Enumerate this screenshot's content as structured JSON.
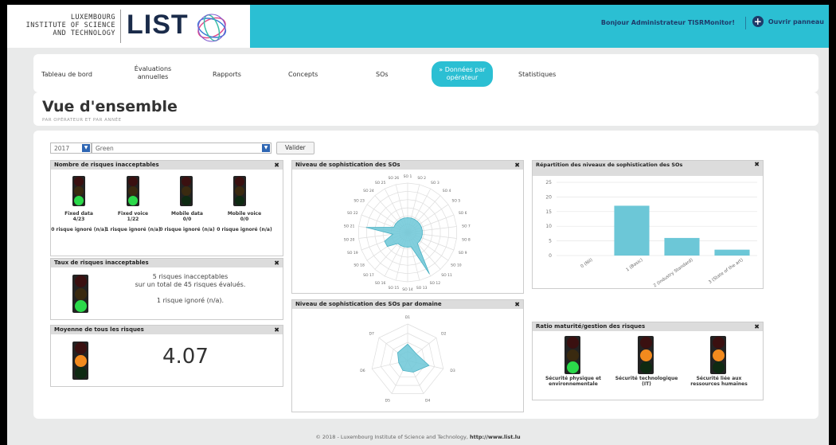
{
  "header": {
    "org_line1": "LUXEMBOURG",
    "org_line2": "INSTITUTE OF SCIENCE",
    "org_line3": "AND TECHNOLOGY",
    "logo_text": "LIST",
    "user_text": "Bonjour Administrateur TISRMonitor!",
    "panel_label": "Ouvrir panneau",
    "accent_color": "#2bbfd3"
  },
  "nav": {
    "items": [
      {
        "label": "Tableau de bord"
      },
      {
        "label": "Évaluations annuelles"
      },
      {
        "label": "Rapports"
      },
      {
        "label": "Concepts"
      },
      {
        "label": "SOs"
      },
      {
        "label": "» Données par opérateur"
      },
      {
        "label": "Statistiques"
      }
    ],
    "active_index": 5
  },
  "page": {
    "title": "Vue d'ensemble",
    "subtitle": "PAR OPÉRATEUR ET PAR ANNÉE"
  },
  "filters": {
    "year": "2017",
    "operator": "Green",
    "validate_label": "Valider"
  },
  "panel_risks": {
    "title": "Nombre de risques inacceptables",
    "items": [
      {
        "name": "Fixed data",
        "ratio": "4/23",
        "ignored": "0 risque ignoré (n/a)",
        "light": "green"
      },
      {
        "name": "Fixed voice",
        "ratio": "1/22",
        "ignored": "1 risque ignoré (n/a)",
        "light": "green"
      },
      {
        "name": "Mobile data",
        "ratio": "0/0",
        "ignored": "0 risque ignoré (n/a)",
        "light": "off"
      },
      {
        "name": "Mobile voice",
        "ratio": "0/0",
        "ignored": "0 risque ignoré (n/a)",
        "light": "off"
      }
    ]
  },
  "panel_rate": {
    "title": "Taux de risques inacceptables",
    "line1": "5 risques inacceptables",
    "line2": "sur un total de 45 risques évalués.",
    "line3": "1 risque ignoré (n/a).",
    "light": "green"
  },
  "panel_avg": {
    "title": "Moyenne de tous les risques",
    "value": "4.07",
    "light": "orange"
  },
  "panel_radar": {
    "title": "Niveau de sophistication des SOs",
    "labels": [
      "SO 1",
      "SO 2",
      "SO 3",
      "SO 4",
      "SO 5",
      "SO 6",
      "SO 7",
      "SO 8",
      "SO 9",
      "SO 10",
      "SO 11",
      "SO 12",
      "SO 13",
      "SO 14",
      "SO 15",
      "SO 16",
      "SO 17",
      "SO 18",
      "SO 19",
      "SO 20",
      "SO 21",
      "SO 22",
      "SO 23",
      "SO 24",
      "SO 25",
      "SO 26"
    ],
    "values": [
      0.3,
      0.3,
      0.3,
      0.3,
      0.3,
      0.3,
      0.3,
      0.3,
      0.3,
      0.3,
      0.3,
      0.95,
      0.3,
      0.3,
      0.3,
      0.3,
      0.3,
      0.5,
      0.5,
      0.3,
      0.85,
      0.3,
      0.3,
      0.3,
      0.3,
      0.3
    ]
  },
  "panel_domain": {
    "title": "Niveau de sophistication des SOs par domaine",
    "labels": [
      "D1",
      "D2",
      "D3",
      "D4",
      "D5",
      "D6",
      "D7"
    ],
    "values": [
      0.45,
      0.3,
      0.6,
      0.35,
      0.3,
      0.25,
      0.35
    ]
  },
  "panel_bars": {
    "title": "Répartition des niveaux de sophistication des SOs",
    "chart_data": {
      "type": "bar",
      "categories": [
        "0 (Nil)",
        "1 (Basic)",
        "2 (Industry Standard)",
        "3 (State of the art)"
      ],
      "values": [
        0,
        17,
        6,
        2
      ],
      "ylim": [
        0,
        25
      ],
      "yticks": [
        "0",
        "5",
        "10",
        "15",
        "20",
        "25"
      ],
      "bar_color": "#6cc7d7"
    }
  },
  "panel_maturity": {
    "title": "Ratio maturité/gestion des risques",
    "items": [
      {
        "name": "Sécurité physique et environnementale",
        "light": "green"
      },
      {
        "name": "Sécurité technologique (IT)",
        "light": "orange"
      },
      {
        "name": "Sécurité liée aux ressources humaines",
        "light": "orange"
      }
    ]
  },
  "footer": {
    "text": "© 2018 - Luxembourg Institute of Science and Technology,",
    "link": "http://www.list.lu"
  }
}
